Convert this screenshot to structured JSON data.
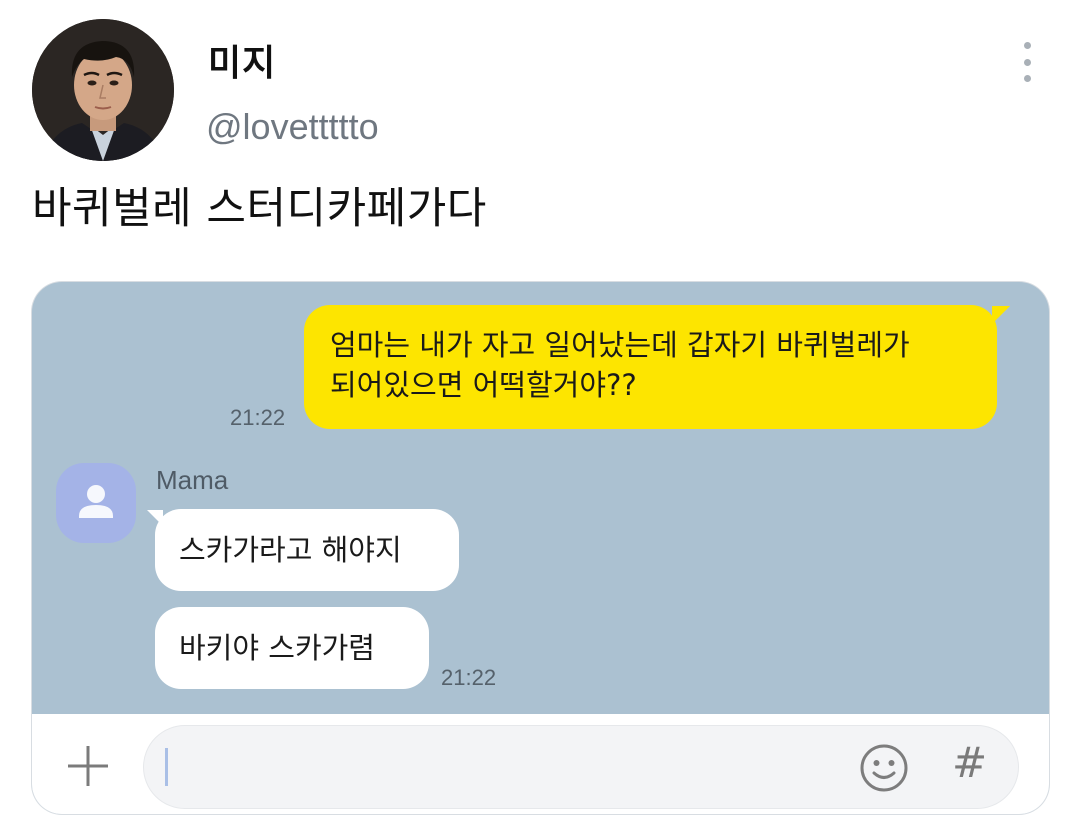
{
  "post": {
    "display_name": "미지",
    "handle": "@lovettttto",
    "text": "바퀴벌레 스터디카페가다",
    "menu_icon": "more-vertical-icon"
  },
  "chat": {
    "background_color": "#abc1d1",
    "sent_bubble_color": "#fde500",
    "messages": [
      {
        "sender": "me",
        "lines": [
          "엄마는 내가 자고 일어났는데 갑자기 바퀴벌레가",
          "되어있으면 어떡할거야??"
        ],
        "time": "21:22"
      },
      {
        "sender": "Mama",
        "text": "스카가라고 해야지"
      },
      {
        "sender": "Mama",
        "text": "바키야 스카가렴",
        "time": "21:22"
      }
    ],
    "contact": {
      "name": "Mama",
      "avatar_icon": "default-profile-icon"
    },
    "input_bar": {
      "value": "",
      "left_icon": "plus-icon",
      "right_icons": [
        "emoji-icon",
        "hash-icon"
      ],
      "hash_glyph": "#"
    }
  }
}
